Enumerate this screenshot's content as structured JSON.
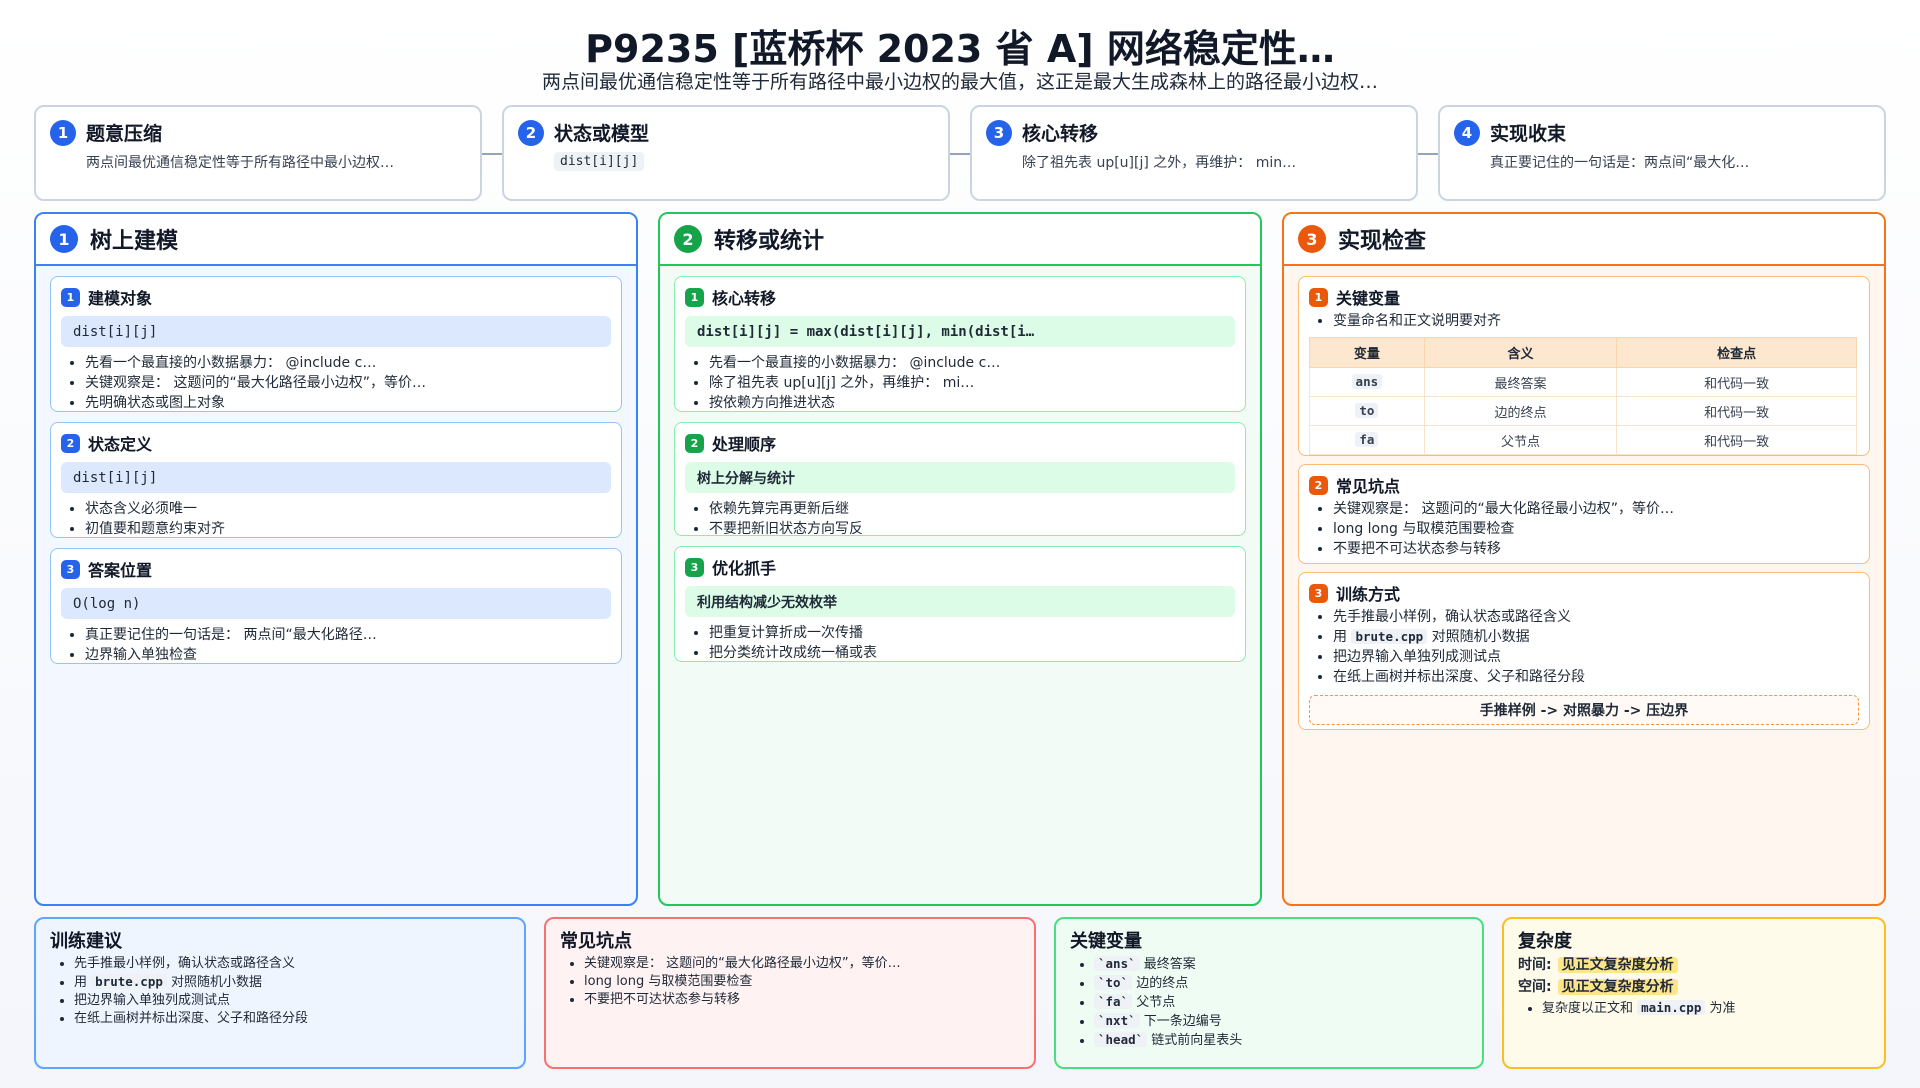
{
  "header": {
    "title": "P9235 [蓝桥杯 2023 省 A] 网络稳定性…",
    "subtitle": "两点间最优通信稳定性等于所有路径中最小边权的最大值，这正是最大生成森林上的路径最小边权…"
  },
  "steps": [
    {
      "num": "1",
      "title": "题意压缩",
      "text": "两点间最优通信稳定性等于所有路径中最小边权…"
    },
    {
      "num": "2",
      "title": "状态或模型",
      "code": "dist[i][j]"
    },
    {
      "num": "3",
      "title": "核心转移",
      "text": "除了祖先表 up[u][j] 之外，再维护： min…"
    },
    {
      "num": "4",
      "title": "实现收束",
      "text": "真正要记住的一句话是：两点间“最大化…"
    }
  ],
  "columns": {
    "left": {
      "num": "1",
      "title": "树上建模",
      "cards": [
        {
          "num": "1",
          "title": "建模对象",
          "code": "dist[i][j]",
          "bullets": [
            "先看一个最直接的小数据暴力： @include c…",
            "关键观察是： 这题问的“最大化路径最小边权”，等价…",
            "先明确状态或图上对象"
          ]
        },
        {
          "num": "2",
          "title": "状态定义",
          "code": "dist[i][j]",
          "bullets": [
            "状态含义必须唯一",
            "初值要和题意约束对齐"
          ]
        },
        {
          "num": "3",
          "title": "答案位置",
          "code": "O(log n)",
          "bullets": [
            "真正要记住的一句话是： 两点间“最大化路径…",
            "边界输入单独检查"
          ]
        }
      ]
    },
    "middle": {
      "num": "2",
      "title": "转移或统计",
      "cards": [
        {
          "num": "1",
          "title": "核心转移",
          "code": "dist[i][j] = max(dist[i][j], min(dist[i…",
          "bullets": [
            "先看一个最直接的小数据暴力： @include c…",
            "除了祖先表 up[u][j] 之外，再维护： mi…",
            "按依赖方向推进状态"
          ]
        },
        {
          "num": "2",
          "title": "处理顺序",
          "highlight": "树上分解与统计",
          "bullets": [
            "依赖先算完再更新后继",
            "不要把新旧状态方向写反"
          ]
        },
        {
          "num": "3",
          "title": "优化抓手",
          "highlight": "利用结构减少无效枚举",
          "bullets": [
            "把重复计算折成一次传播",
            "把分类统计改成统一桶或表"
          ]
        }
      ]
    },
    "right": {
      "num": "3",
      "title": "实现检查",
      "card1": {
        "num": "1",
        "title": "关键变量",
        "note": "变量命名和正文说明要对齐",
        "headers": [
          "变量",
          "含义",
          "检查点"
        ],
        "rows": [
          [
            "ans",
            "最终答案",
            "和代码一致"
          ],
          [
            "to",
            "边的终点",
            "和代码一致"
          ],
          [
            "fa",
            "父节点",
            "和代码一致"
          ]
        ]
      },
      "card2": {
        "num": "2",
        "title": "常见坑点",
        "bullets": [
          "关键观察是： 这题问的“最大化路径最小边权”，等价…",
          "long long 与取模范围要检查",
          "不要把不可达状态参与转移"
        ]
      },
      "card3": {
        "num": "3",
        "title": "训练方式",
        "b1": "先手推最小样例，确认状态或路径含义",
        "b2_pre": "用",
        "b2_code": "brute.cpp",
        "b2_post": "对照随机小数据",
        "b3": "把边界输入单独列成测试点",
        "b4": "在纸上画树并标出深度、父子和路径分段",
        "flow": "手推样例 -> 对照暴力 -> 压边界"
      }
    }
  },
  "bottom": {
    "training": {
      "title": "训练建议",
      "b1": "先手推最小样例，确认状态或路径含义",
      "b2_pre": "用",
      "b2_code": "brute.cpp",
      "b2_post": "对照随机小数据",
      "b3": "把边界输入单独列成测试点",
      "b4": "在纸上画树并标出深度、父子和路径分段"
    },
    "pitfalls": {
      "title": "常见坑点",
      "bullets": [
        "关键观察是： 这题问的“最大化路径最小边权”，等价…",
        "long long 与取模范围要检查",
        "不要把不可达状态参与转移"
      ]
    },
    "variables": {
      "title": "关键变量",
      "items": [
        {
          "code": "`ans`",
          "desc": "最终答案"
        },
        {
          "code": "`to`",
          "desc": "边的终点"
        },
        {
          "code": "`fa`",
          "desc": "父节点"
        },
        {
          "code": "`nxt`",
          "desc": "下一条边编号"
        },
        {
          "code": "`head`",
          "desc": "链式前向星表头"
        }
      ]
    },
    "complexity": {
      "title": "复杂度",
      "time_label": "时间:",
      "time_value": "见正文复杂度分析",
      "space_label": "空间:",
      "space_value": "见正文复杂度分析",
      "note_pre": "复杂度以正文和",
      "note_code": "main.cpp",
      "note_post": "为准"
    }
  }
}
